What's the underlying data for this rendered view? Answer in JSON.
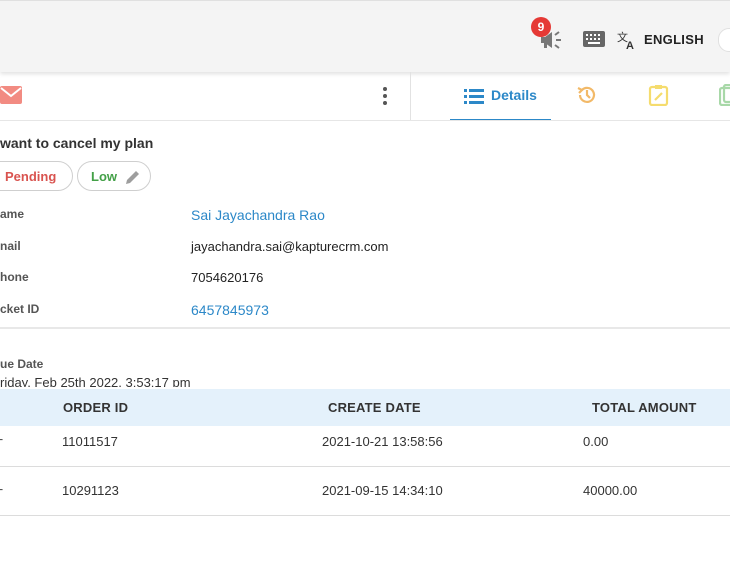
{
  "topbar": {
    "notification_count": "9",
    "language": "ENGLISH"
  },
  "tabs": {
    "details": "Details"
  },
  "ticket": {
    "subject": "want to cancel my plan",
    "status": "Pending",
    "priority": "Low"
  },
  "fields": [
    {
      "label": "ame",
      "value": "Sai Jayachandra Rao"
    },
    {
      "label": "nail",
      "value": "jayachandra.sai@kapturecrm.com"
    },
    {
      "label": "hone",
      "value": "7054620176"
    },
    {
      "label": "cket ID",
      "value": "6457845973"
    }
  ],
  "due": {
    "label": "ue Date",
    "value": "riday, Feb 25th 2022, 3:53:17 pm"
  },
  "orders": {
    "headers": [
      "ORDER ID",
      "CREATE DATE",
      "TOTAL AMOUNT"
    ],
    "rows": [
      {
        "order_id": "11011517",
        "create_date": "2021-10-21 13:58:56",
        "total": "0.00"
      },
      {
        "order_id": "10291123",
        "create_date": "2021-09-15 14:34:10",
        "total": "40000.00"
      }
    ]
  },
  "colors": {
    "accent": "#2c88c8",
    "badge": "#e53935",
    "pending": "#d9534f",
    "low": "#43a047",
    "table_header_bg": "#e4f1fb"
  },
  "icons": [
    "announcement-icon",
    "keyboard-icon",
    "translate-icon",
    "mail-icon",
    "more-vertical-icon",
    "list-icon",
    "history-icon",
    "note-icon",
    "copy-icon",
    "pencil-icon",
    "plus-icon"
  ]
}
